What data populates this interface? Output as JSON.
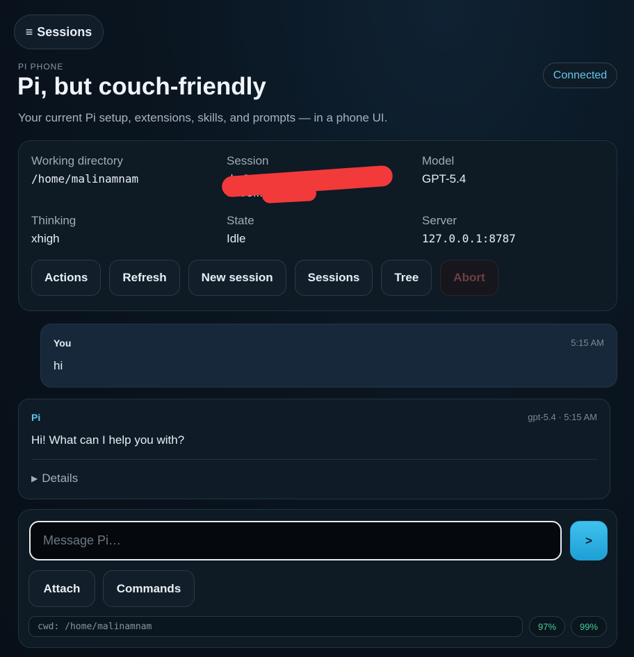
{
  "header": {
    "menu_icon": "≡",
    "sessions_label": "Sessions",
    "eyebrow": "PI PHONE",
    "title": "Pi, but couch-friendly",
    "subtitle": "Your current Pi setup, extensions, skills, and prompts — in a phone UI.",
    "status": "Connected",
    "accent_color": "#63c6ea"
  },
  "info": {
    "working_directory_label": "Working directory",
    "working_directory": "/home/malinamnam",
    "session_label": "Session",
    "session_value_line1": "-bc30-38-acbd-11f-4-3f7",
    "session_value_line2": "9703...",
    "model_label": "Model",
    "model": "GPT-5.4",
    "thinking_label": "Thinking",
    "thinking": "xhigh",
    "state_label": "State",
    "state": "Idle",
    "server_label": "Server",
    "server": "127.0.0.1:8787"
  },
  "actions": [
    "Actions",
    "Refresh",
    "New session",
    "Sessions",
    "Tree",
    "Abort"
  ],
  "messages": {
    "user": {
      "author": "You",
      "time": "5:15 AM",
      "text": "hi"
    },
    "pi": {
      "author": "Pi",
      "meta": "gpt-5.4 · 5:15 AM",
      "text": "Hi! What can I help you with?",
      "details_label": "Details"
    }
  },
  "composer": {
    "placeholder": "Message Pi…",
    "send_label": ">",
    "attach_label": "Attach",
    "commands_label": "Commands",
    "cwd": "cwd: /home/malinamnam",
    "usage_1": "97%",
    "usage_2": "99%"
  }
}
